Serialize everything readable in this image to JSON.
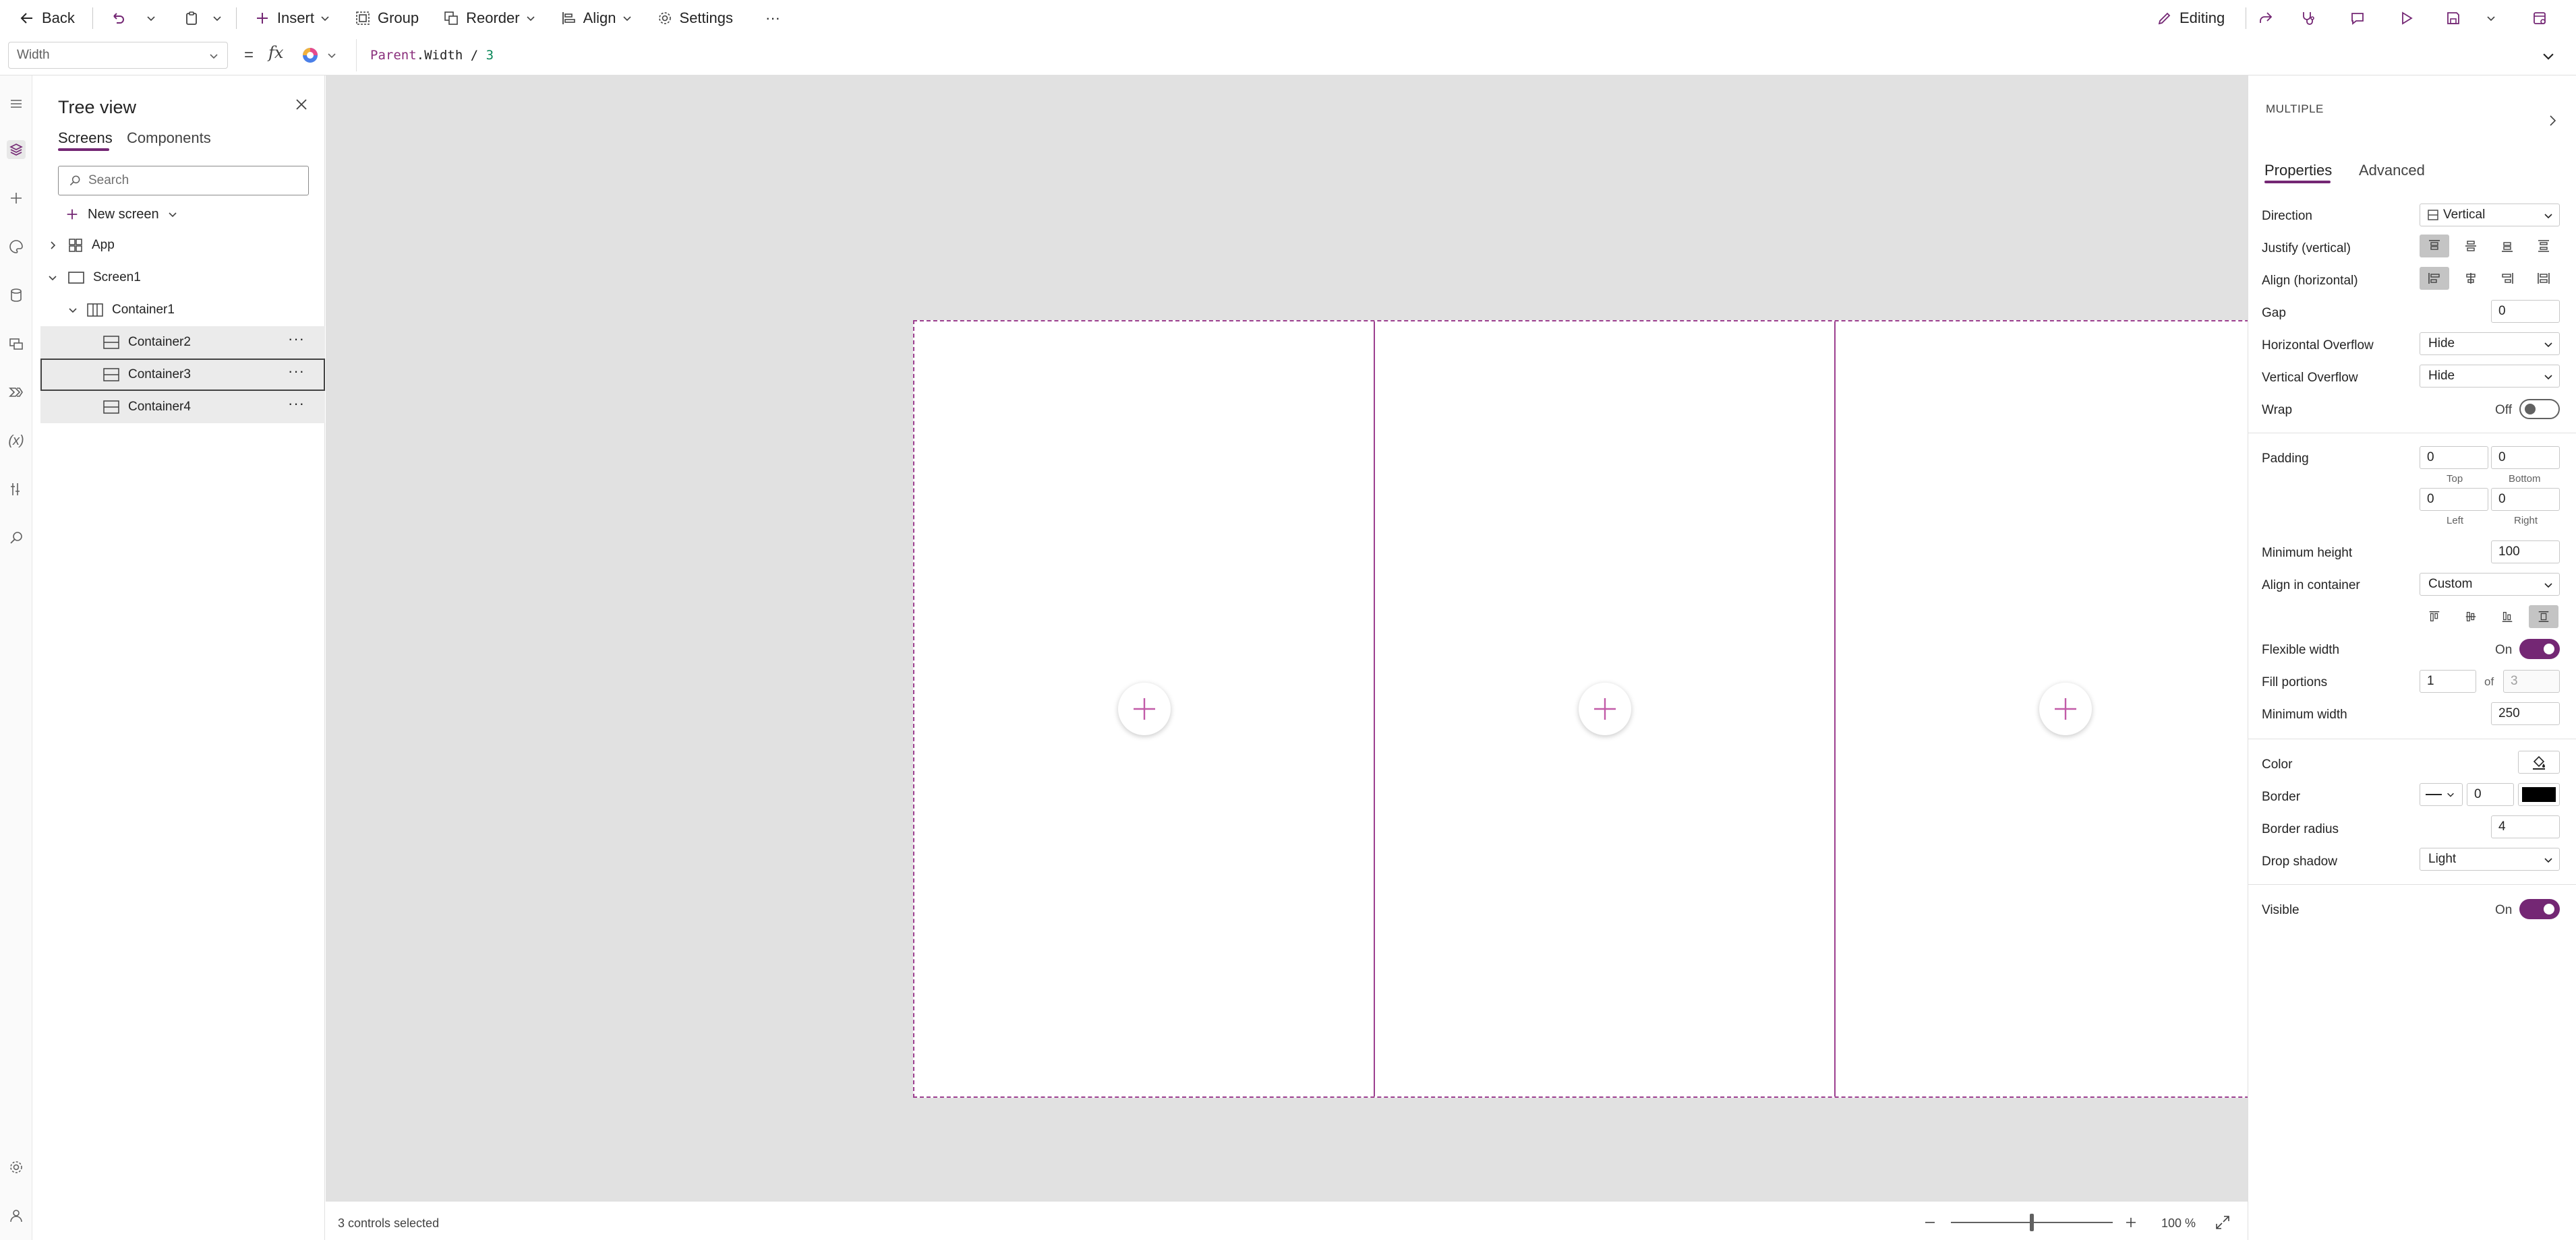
{
  "toolbar": {
    "back_label": "Back",
    "insert_label": "Insert",
    "group_label": "Group",
    "reorder_label": "Reorder",
    "align_label": "Align",
    "settings_label": "Settings",
    "more_label": "···",
    "editing_label": "Editing"
  },
  "formula": {
    "property": "Width",
    "keyword": "Parent",
    "rest": ".Width / ",
    "number": "3"
  },
  "tree": {
    "title": "Tree view",
    "tab_screens": "Screens",
    "tab_components": "Components",
    "search_placeholder": "Search",
    "new_screen_label": "New screen",
    "nodes": [
      {
        "label": "App"
      },
      {
        "label": "Screen1"
      },
      {
        "label": "Container1"
      },
      {
        "label": "Container2"
      },
      {
        "label": "Container3"
      },
      {
        "label": "Container4"
      }
    ],
    "more_label": "···"
  },
  "status": {
    "selection_text": "3 controls selected",
    "zoom": "100 %"
  },
  "props": {
    "header": "MULTIPLE",
    "tab_properties": "Properties",
    "tab_advanced": "Advanced",
    "direction_label": "Direction",
    "direction_value": "Vertical",
    "justify_label": "Justify (vertical)",
    "align_label": "Align (horizontal)",
    "gap_label": "Gap",
    "gap_value": "0",
    "h_overflow_label": "Horizontal Overflow",
    "h_overflow_value": "Hide",
    "v_overflow_label": "Vertical Overflow",
    "v_overflow_value": "Hide",
    "wrap_label": "Wrap",
    "wrap_state": "Off",
    "padding_label": "Padding",
    "padding_top": "0",
    "padding_bottom": "0",
    "padding_left": "0",
    "padding_right": "0",
    "top_sub": "Top",
    "bottom_sub": "Bottom",
    "left_sub": "Left",
    "right_sub": "Right",
    "min_height_label": "Minimum height",
    "min_height_value": "100",
    "align_container_label": "Align in container",
    "align_container_value": "Custom",
    "flex_width_label": "Flexible width",
    "flex_width_state": "On",
    "fill_portions_label": "Fill portions",
    "fill_portions_value": "1",
    "fill_portions_of": "of",
    "fill_portions_total": "3",
    "min_width_label": "Minimum width",
    "min_width_value": "250",
    "color_label": "Color",
    "border_label": "Border",
    "border_value": "0",
    "border_radius_label": "Border radius",
    "border_radius_value": "4",
    "drop_shadow_label": "Drop shadow",
    "drop_shadow_value": "Light",
    "visible_label": "Visible",
    "visible_state": "On"
  },
  "colors": {
    "accent": "#742774",
    "container_outline": "#9c3f8f",
    "canvas_bg": "#e1e1e1",
    "border_swatch": "#000000"
  }
}
